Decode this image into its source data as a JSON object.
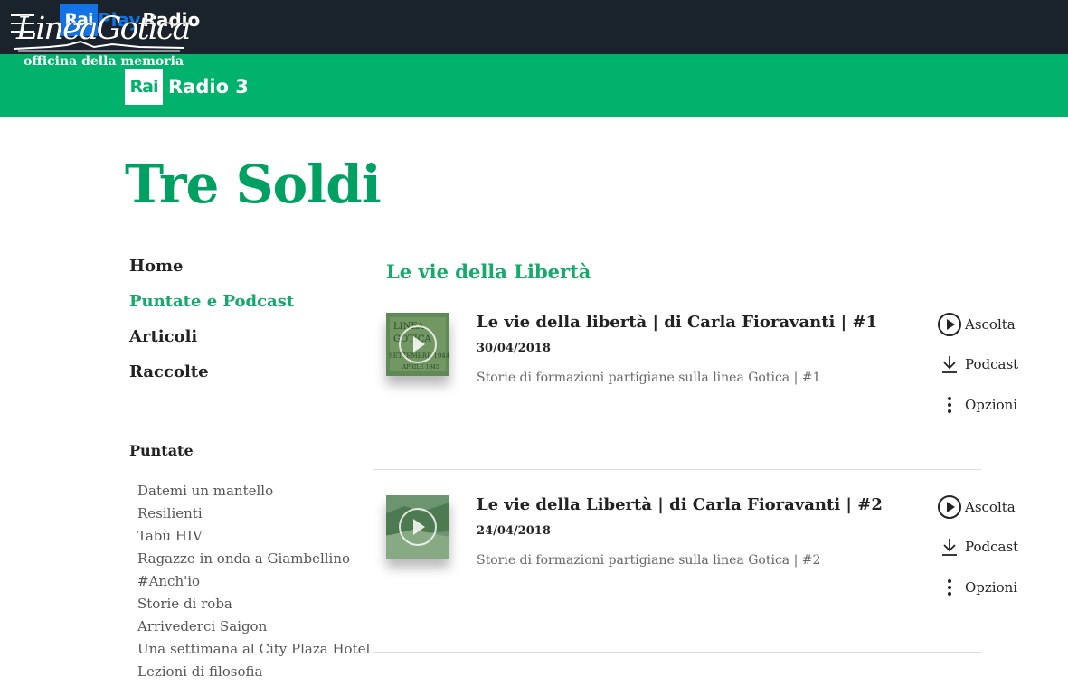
{
  "header": {
    "brand_rai": "Rai",
    "brand_play": "Play",
    "brand_radio": "Radio",
    "overlay_logo_title": "LineaGotica",
    "overlay_logo_subtitle": "officina della memoria"
  },
  "channel": {
    "rai": "Rai",
    "name": "Radio 3"
  },
  "program": {
    "title": "Tre Soldi"
  },
  "nav": {
    "items": [
      {
        "label": "Home",
        "active": false
      },
      {
        "label": "Puntate e Podcast",
        "active": true
      },
      {
        "label": "Articoli",
        "active": false
      },
      {
        "label": "Raccolte",
        "active": false
      }
    ]
  },
  "sidebar": {
    "section_label": "Puntate",
    "series": [
      "Datemi un mantello",
      "Resilienti",
      "Tabù HIV",
      "Ragazze in onda a Giambellino",
      "#Anch'io",
      "Storie di roba",
      "Arrivederci Saigon",
      "Una settimana al City Plaza Hotel",
      "Lezioni di filosofia"
    ]
  },
  "main": {
    "section_title": "Le vie della Libertà",
    "episodes": [
      {
        "title": "Le vie della libertà | di Carla Fioravanti | #1",
        "date": "30/04/2018",
        "description": "Storie di formazioni partigiane sulla linea Gotica | #1",
        "thumb_text": "LINEA GOTICA SETTEMBRE 1944 APRILE 1945"
      },
      {
        "title": "Le vie della Libertà | di Carla Fioravanti | #2",
        "date": "24/04/2018",
        "description": "Storie di formazioni partigiane sulla linea Gotica | #2",
        "thumb_text": ""
      }
    ],
    "actions": {
      "listen": "Ascolta",
      "podcast": "Podcast",
      "options": "Opzioni"
    }
  },
  "colors": {
    "topbar": "#1a232b",
    "green": "#00b26b",
    "title_green": "#00a063",
    "rai_blue": "#1173e5"
  }
}
